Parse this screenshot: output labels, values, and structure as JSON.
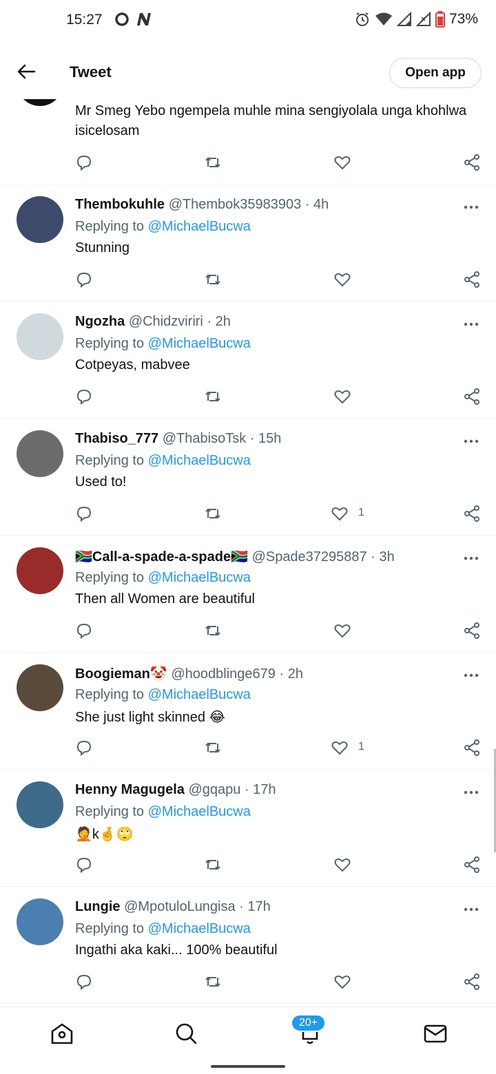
{
  "status_bar": {
    "time": "15:27",
    "battery": "73%"
  },
  "header": {
    "title": "Tweet",
    "open_app": "Open app"
  },
  "replying_label": "Replying to",
  "first_tweet": {
    "text_line1": "Mr Smeg Yebo ngempela muhle mina sengiyolala unga khohlwa",
    "text_line2": "isicelosam"
  },
  "tweets": [
    {
      "name": "Thembokuhle",
      "handle": "@Thembok35983903",
      "time": "· 4h",
      "reply_to": "@MichaelBucwa",
      "text": "Stunning",
      "likes": ""
    },
    {
      "name": "Ngozha",
      "handle": "@Chidzviriri",
      "time": "· 2h",
      "reply_to": "@MichaelBucwa",
      "text": "Cotpeyas, mabvee",
      "likes": ""
    },
    {
      "name": "Thabiso_777",
      "handle": "@ThabisoTsk",
      "time": "· 15h",
      "reply_to": "@MichaelBucwa",
      "text": "Used to!",
      "likes": "1"
    },
    {
      "name": "🇿🇦Call-a-spade-a-spade🇿🇦",
      "handle": "@Spade37295887",
      "time": "· 3h",
      "reply_to": "@MichaelBucwa",
      "text": "Then all Women are beautiful",
      "likes": ""
    },
    {
      "name": "Boogieman🤡",
      "handle": "@hoodblinge679",
      "time": "· 2h",
      "reply_to": "@MichaelBucwa",
      "text": "She just light skinned 😂",
      "likes": "1"
    },
    {
      "name": "Henny Magugela",
      "handle": "@gqapu",
      "time": "· 17h",
      "reply_to": "@MichaelBucwa",
      "text": "🤦k🤞🙄",
      "likes": ""
    },
    {
      "name": "Lungie",
      "handle": "@MpotuloLungisa",
      "time": "· 17h",
      "reply_to": "@MichaelBucwa",
      "text": "Ingathi aka kaki... 100% beautiful",
      "likes": ""
    }
  ],
  "nav": {
    "notifications_badge": "20+"
  },
  "colors": {
    "accent": "#1d9bf0",
    "muted": "#536471",
    "text": "#0f1419"
  }
}
